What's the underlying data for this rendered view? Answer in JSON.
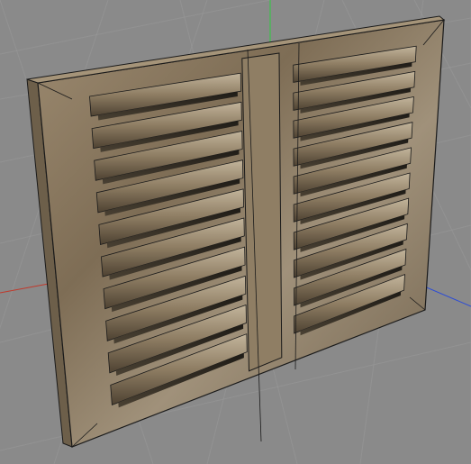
{
  "viewport": {
    "background_color": "#8a8a8a",
    "grid_color": "#9a9a9a",
    "axis_colors": {
      "x": "#c0392b",
      "y": "#2ecc40",
      "z": "#2b4bd6"
    }
  },
  "model": {
    "type": "louvered-vent-panel",
    "material_color": "#8c7b62",
    "edge_color": "#1a1a1a",
    "louver_rows": 10,
    "louver_columns": 2
  }
}
